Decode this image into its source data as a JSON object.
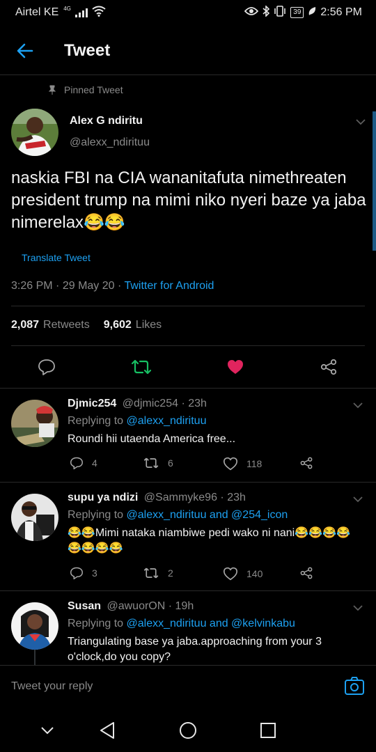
{
  "status": {
    "carrier": "Airtel KE",
    "network": "4G",
    "battery": "39",
    "time": "2:56 PM",
    "icons": [
      "signal-icon",
      "wifi-icon",
      "eye-icon",
      "bluetooth-icon",
      "vibrate-icon",
      "battery-icon",
      "leaf-icon"
    ]
  },
  "header": {
    "title": "Tweet",
    "back_icon": "arrow-left-icon"
  },
  "tweet": {
    "pinned_label": "Pinned Tweet",
    "author_name": "Alex G ndiritu",
    "author_handle": "@alexx_ndirituu",
    "text": "naskia FBI na CIA wananitafuta nimethreaten president trump na mimi niko nyeri baze ya jaba nimerelax😂😂",
    "translate": "Translate Tweet",
    "time": "3:26 PM",
    "date": "29 May 20",
    "source": "Twitter for Android",
    "retweets_count": "2,087",
    "retweets_label": "Retweets",
    "likes_count": "9,602",
    "likes_label": "Likes",
    "actions": [
      "comment-icon",
      "retweet-icon",
      "like-icon",
      "share-icon"
    ],
    "colors": {
      "retweet": "#17bf63",
      "like": "#e0245e",
      "link": "#1da1f2"
    }
  },
  "replies": [
    {
      "name": "Djmic254",
      "handle": "@djmic254",
      "time": "23h",
      "replying_label": "Replying to",
      "mentions": "@alexx_ndirituu",
      "text": "Roundi hii utaenda America free...",
      "comments": "4",
      "retweets": "6",
      "likes": "118"
    },
    {
      "name": "supu ya ndizi",
      "handle": "@Sammyke96",
      "time": "23h",
      "replying_label": "Replying to",
      "mentions": "@alexx_ndirituu and @254_icon",
      "text": "😂😂Mimi nataka niambiwe pedi wako ni nani😂😂😂😂😂😂😂😂",
      "comments": "3",
      "retweets": "2",
      "likes": "140"
    },
    {
      "name": "Susan",
      "handle": "@awuorON",
      "time": "19h",
      "replying_label": "Replying to",
      "mentions": "@alexx_ndirituu and @kelvinkabu",
      "text": "Triangulating base ya jaba.approaching from your 3 o'clock,do you copy?"
    }
  ],
  "reply_bar": {
    "placeholder": "Tweet your reply",
    "camera_icon": "camera-icon"
  },
  "nav": [
    "nav-down-icon",
    "nav-back-icon",
    "nav-home-icon",
    "nav-recents-icon"
  ]
}
